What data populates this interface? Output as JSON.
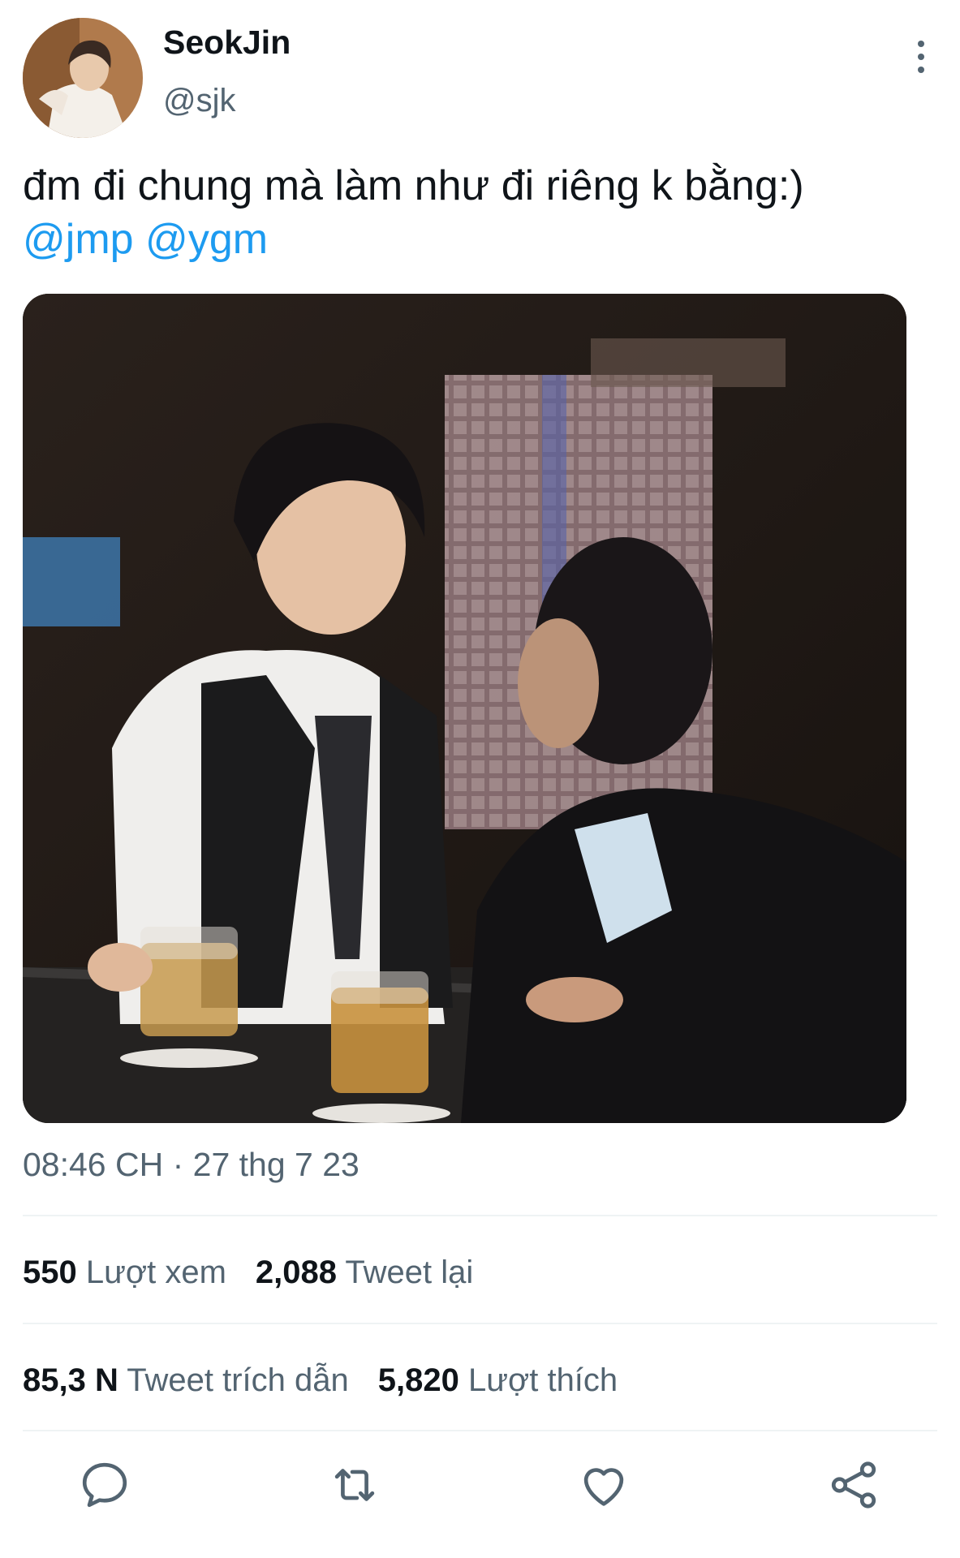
{
  "author": {
    "display_name": "SeokJin",
    "handle": "@sjk",
    "avatar_icon": "profile-photo"
  },
  "tweet": {
    "text": "đm đi chung  mà làm như đi riêng k bằng:)",
    "mentions": [
      "@jmp",
      "@ygm"
    ],
    "image_description_icon": "photo-two-people-at-bar",
    "timestamp": "08:46 CH · 27 thg 7 23"
  },
  "stats": {
    "views_count": "550",
    "views_label": "Lượt xem",
    "retweets_count": "2,088",
    "retweets_label": "Tweet lại",
    "quotes_count": "85,3 N",
    "quotes_label": "Tweet trích dẫn",
    "likes_count": "5,820",
    "likes_label": "Lượt thích"
  },
  "actions": {
    "reply_icon": "reply-icon",
    "retweet_icon": "retweet-icon",
    "like_icon": "heart-icon",
    "share_icon": "share-icon"
  },
  "colors": {
    "link": "#1d9bf0",
    "muted": "#536471",
    "text": "#0f1419",
    "divider": "#eff3f4"
  }
}
